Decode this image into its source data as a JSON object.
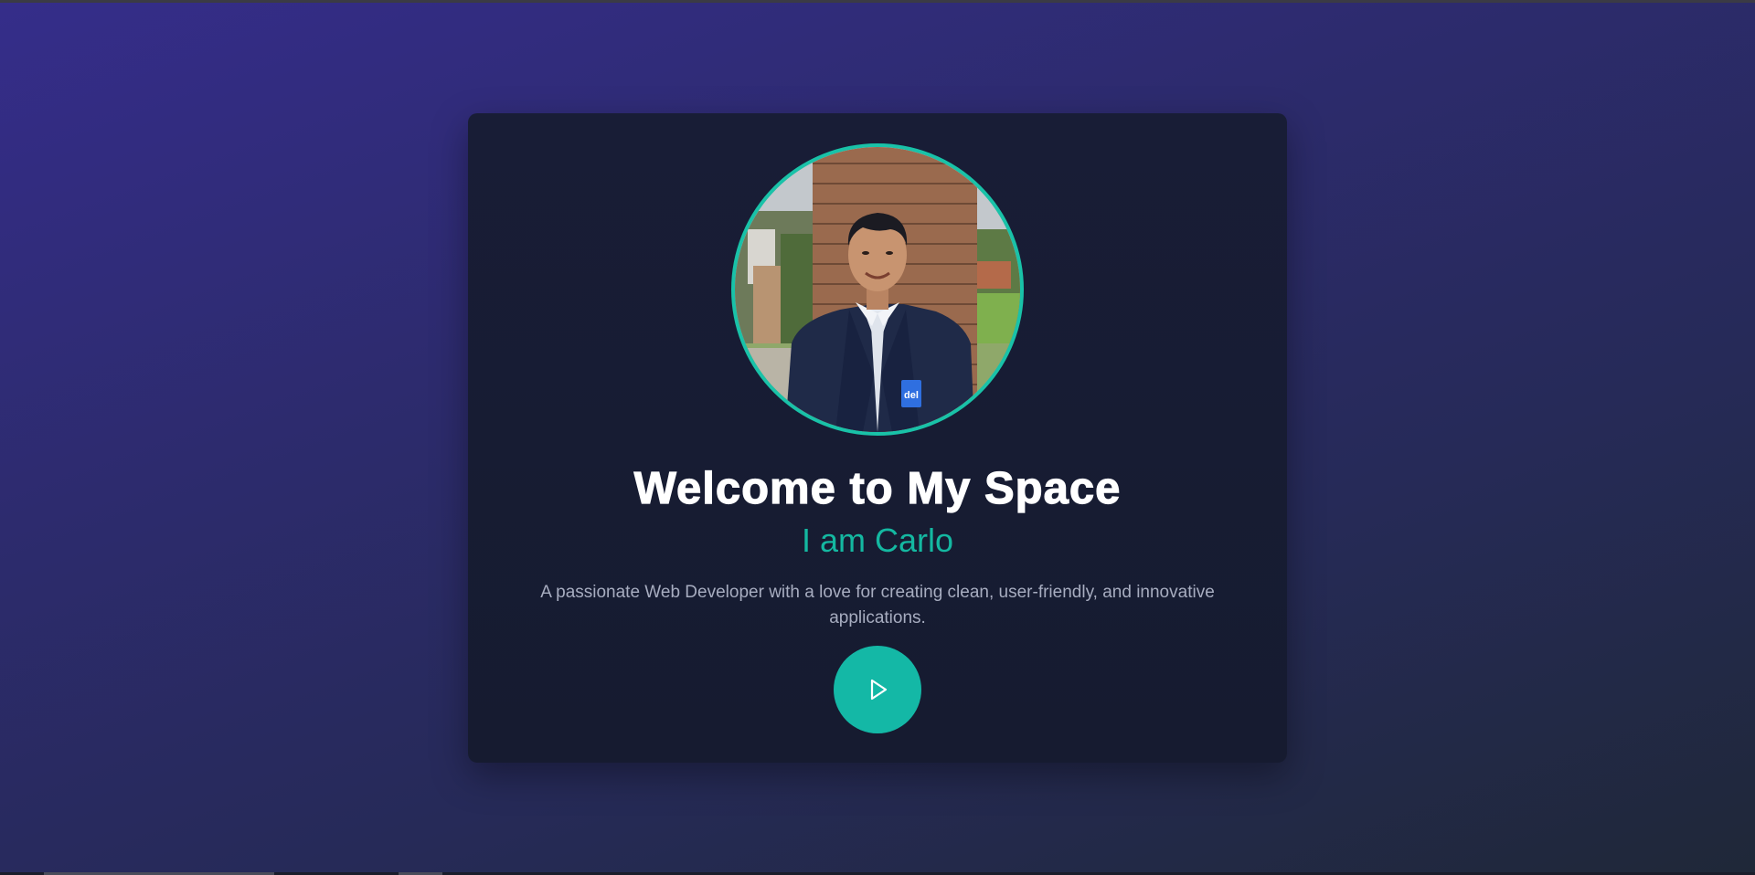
{
  "hero": {
    "title": "Welcome to My Space",
    "subtitle": "I am Carlo",
    "description": "A passionate Web Developer with a love for creating clean, user-friendly, and innovative applications."
  },
  "avatar": {
    "alt": "Profile photo of Carlo",
    "badge_text": "del"
  },
  "play_button": {
    "icon": "play-icon"
  },
  "colors": {
    "accent": "#14b8a6",
    "card_bg": "#181d36",
    "title": "#ffffff",
    "description": "#a7adc0"
  }
}
